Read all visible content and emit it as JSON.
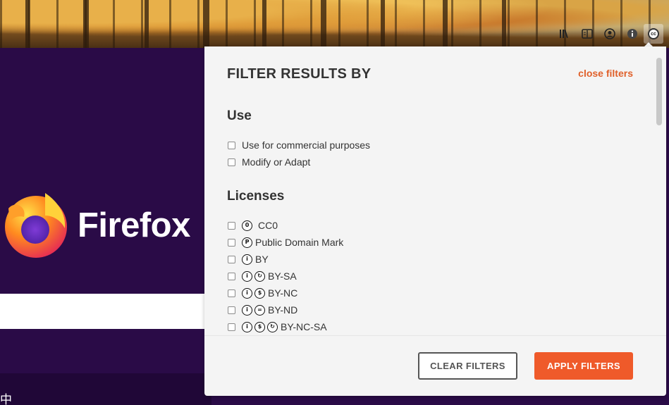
{
  "toolbar": {
    "icons": [
      "library-icon",
      "reader-view-icon",
      "extension-icon",
      "account-icon",
      "info-icon",
      "cc-extension-icon"
    ]
  },
  "page": {
    "brand": "Firefox",
    "cjk_char": "中"
  },
  "filters": {
    "title": "FILTER RESULTS BY",
    "close_label": "close filters",
    "use_heading": "Use",
    "use_options": [
      {
        "label": "Use for commercial purposes",
        "checked": false
      },
      {
        "label": "Modify or Adapt",
        "checked": false
      }
    ],
    "licenses_heading": "Licenses",
    "licenses": [
      {
        "label": "CC0",
        "icons": [
          "zero-icon"
        ],
        "checked": false
      },
      {
        "label": "Public Domain Mark",
        "icons": [
          "pd-icon"
        ],
        "checked": false
      },
      {
        "label": "BY",
        "icons": [
          "by-icon"
        ],
        "checked": false
      },
      {
        "label": "BY-SA",
        "icons": [
          "by-icon",
          "sa-icon"
        ],
        "checked": false
      },
      {
        "label": "BY-NC",
        "icons": [
          "by-icon",
          "nc-icon"
        ],
        "checked": false
      },
      {
        "label": "BY-ND",
        "icons": [
          "by-icon",
          "nd-icon"
        ],
        "checked": false
      },
      {
        "label": "BY-NC-SA",
        "icons": [
          "by-icon",
          "nc-icon",
          "sa-icon"
        ],
        "checked": false
      }
    ],
    "clear_label": "CLEAR FILTERS",
    "apply_label": "APPLY FILTERS"
  },
  "colors": {
    "accent": "#ef5a2a",
    "page_bg": "#2a0b47",
    "panel_bg": "#f4f4f4"
  }
}
